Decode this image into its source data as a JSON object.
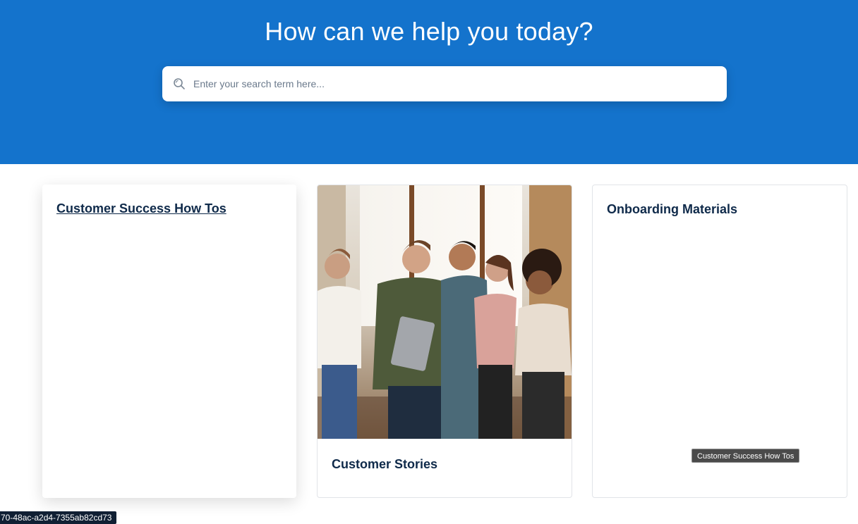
{
  "hero": {
    "title": "How can we help you today?",
    "background_color": "#1473cc"
  },
  "search": {
    "placeholder": "Enter your search term here...",
    "value": "",
    "icon": "search-icon"
  },
  "cards": [
    {
      "title": "Customer Success How Tos",
      "has_image": false
    },
    {
      "title": "Customer Stories",
      "has_image": true,
      "image": "group of five smiling coworkers in an office"
    },
    {
      "title": "Onboarding Materials",
      "has_image": false
    }
  ],
  "tooltip": {
    "text": "Customer Success How Tos"
  },
  "id_badge": {
    "text": "70-48ac-a2d4-7355ab82cd73"
  },
  "colors": {
    "accent": "#1473cc",
    "heading": "#0f2a4a"
  }
}
